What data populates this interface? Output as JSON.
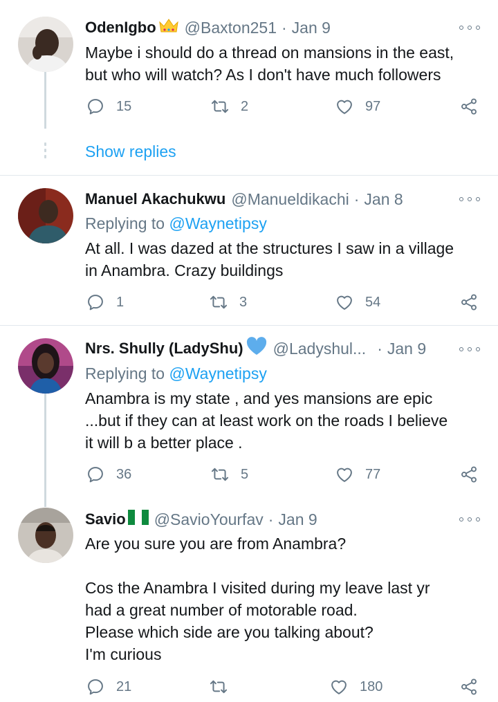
{
  "tweets": [
    {
      "name": "OdenIgbo",
      "handle": "@Baxton251",
      "date": "Jan 9",
      "text": "Maybe i should do a thread on mansions in the east,\nbut who will watch? As I don't have much followers",
      "replies": "15",
      "retweets": "2",
      "likes": "97",
      "show_replies": "Show replies",
      "badge_icon": "crown-emoji"
    },
    {
      "name": "Manuel Akachukwu",
      "handle": "@Manueldikachi",
      "date": "Jan 8",
      "replying_label": "Replying to",
      "replying_to": "@Waynetipsy",
      "text": "At all. I was dazed at the structures I saw in a village\nin Anambra. Crazy buildings",
      "replies": "1",
      "retweets": "3",
      "likes": "54"
    },
    {
      "name": "Nrs. Shully (LadyShu)",
      "handle": "@Ladyshul...",
      "date": "Jan 9",
      "replying_label": "Replying to",
      "replying_to": "@Waynetipsy",
      "text": "Anambra is my state , and yes mansions are epic\n...but if they can at least work on the roads I believe\nit will b a better place .",
      "replies": "36",
      "retweets": "5",
      "likes": "77",
      "badge_icon": "blue-heart-emoji"
    },
    {
      "name": "Savio",
      "handle": "@SavioYourfav",
      "date": "Jan 9",
      "text": "Are you sure you are from Anambra?\n\nCos the Anambra I visited during my leave last yr\nhad a great number of motorable road.\nPlease which side are you talking about?\nI'm curious",
      "replies": "21",
      "retweets": "",
      "likes": "180",
      "badge_icon": "nigeria-flag-emoji"
    }
  ],
  "separator_dot": "·",
  "colors": {
    "accent": "#1da1f2",
    "secondary": "#657786",
    "text": "#14171a"
  }
}
